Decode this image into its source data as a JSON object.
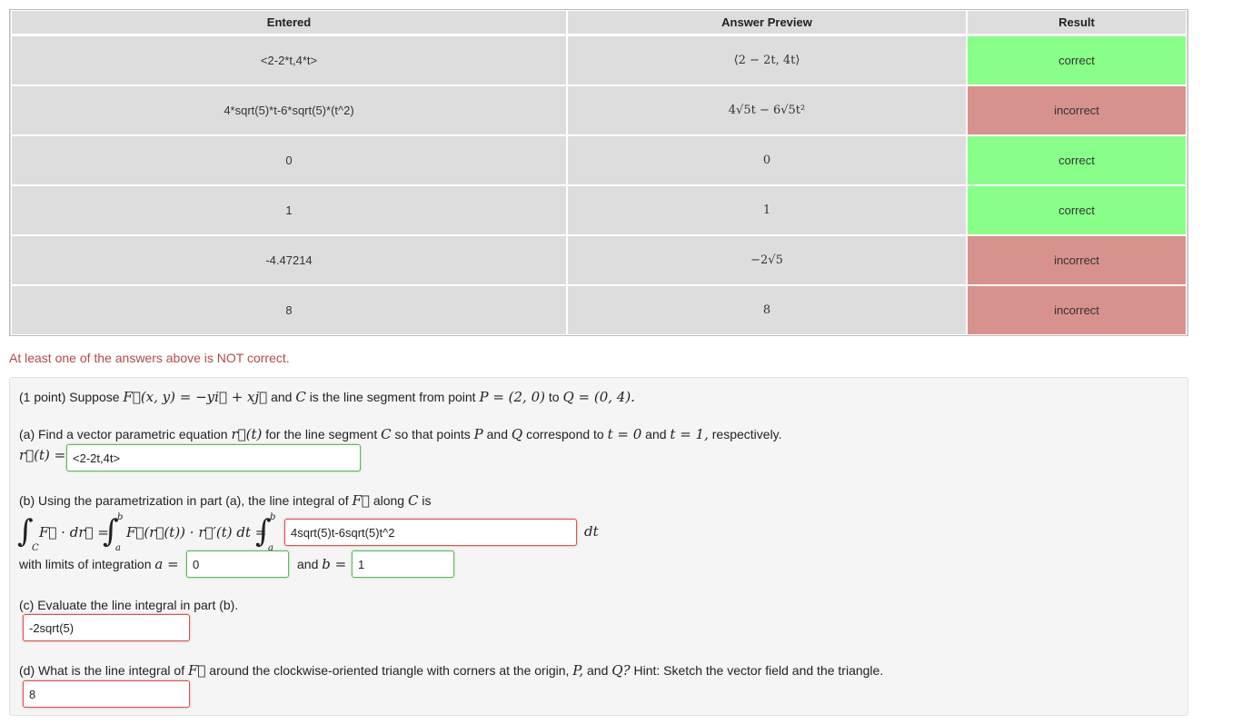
{
  "table": {
    "headers": [
      "Entered",
      "Answer Preview",
      "Result"
    ],
    "rows": [
      {
        "entered": "<2-2*t,4*t>",
        "preview": "⟨2 − 2t, 4t⟩",
        "result": "correct"
      },
      {
        "entered": "4*sqrt(5)*t-6*sqrt(5)*(t^2)",
        "preview": "4√5t − 6√5t²",
        "result": "incorrect"
      },
      {
        "entered": "0",
        "preview": "0",
        "result": "correct"
      },
      {
        "entered": "1",
        "preview": "1",
        "result": "correct"
      },
      {
        "entered": "-4.47214",
        "preview": "−2√5",
        "result": "incorrect"
      },
      {
        "entered": "8",
        "preview": "8",
        "result": "incorrect"
      }
    ]
  },
  "status_message": "At least one of the answers above is NOT correct.",
  "problem": {
    "intro_prefix": "(1 point) Suppose",
    "intro_F": "F⃗(x, y) = −yi⃗ + xj⃗",
    "intro_mid1": "and",
    "intro_C": "C",
    "intro_mid2": "is the line segment from point",
    "intro_P": "P = (2, 0)",
    "intro_to": "to",
    "intro_Q": "Q = (0, 4).",
    "a_text_1": "(a) Find a vector parametric equation",
    "a_rt": "r⃗(t)",
    "a_text_2": "for the line segment",
    "a_C": "C",
    "a_text_3": "so that points",
    "a_P": "P",
    "a_and": "and",
    "a_Q": "Q",
    "a_text_4": "correspond to",
    "a_t0": "t = 0",
    "a_and2": "and",
    "a_t1": "t = 1,",
    "a_text_5": "respectively.",
    "a_label": "r⃗(t) =",
    "a_answer": "<2-2t,4t>",
    "b_text_1": "(b) Using the parametrization in part (a), the line integral of",
    "b_F": "F⃗",
    "b_text_2": "along",
    "b_C": "C",
    "b_text_3": "is",
    "b_integrand1": "F⃗ · dr⃗ =",
    "b_integrand2": "F⃗(r⃗(t)) · r⃗′(t) dt =",
    "b_answer": "4sqrt(5)t-6sqrt(5)t^2",
    "b_dt": "dt",
    "b_sub_C": "C",
    "b_sub_a": "a",
    "b_sup_b": "b",
    "b_limits_text": "with limits of integration",
    "b_a_eq": "a =",
    "b_a_answer": "0",
    "b_and": "and",
    "b_b_eq": "b =",
    "b_b_answer": "1",
    "c_text": "(c) Evaluate the line integral in part (b).",
    "c_answer": "-2sqrt(5)",
    "d_text_1": "(d) What is the line integral of",
    "d_F": "F⃗",
    "d_text_2": "around the clockwise-oriented triangle with corners at the origin,",
    "d_P": "P,",
    "d_and": "and",
    "d_Q": "Q?",
    "d_text_3": "Hint: Sketch the vector field and the triangle.",
    "d_answer": "8"
  },
  "colors": {
    "correct_bg": "#88ff88",
    "incorrect_bg": "#d8928e",
    "result_text": "#2a55b8",
    "status_text": "#b44a4a",
    "correct_border": "#5cb85c",
    "incorrect_border": "#d9534f"
  }
}
